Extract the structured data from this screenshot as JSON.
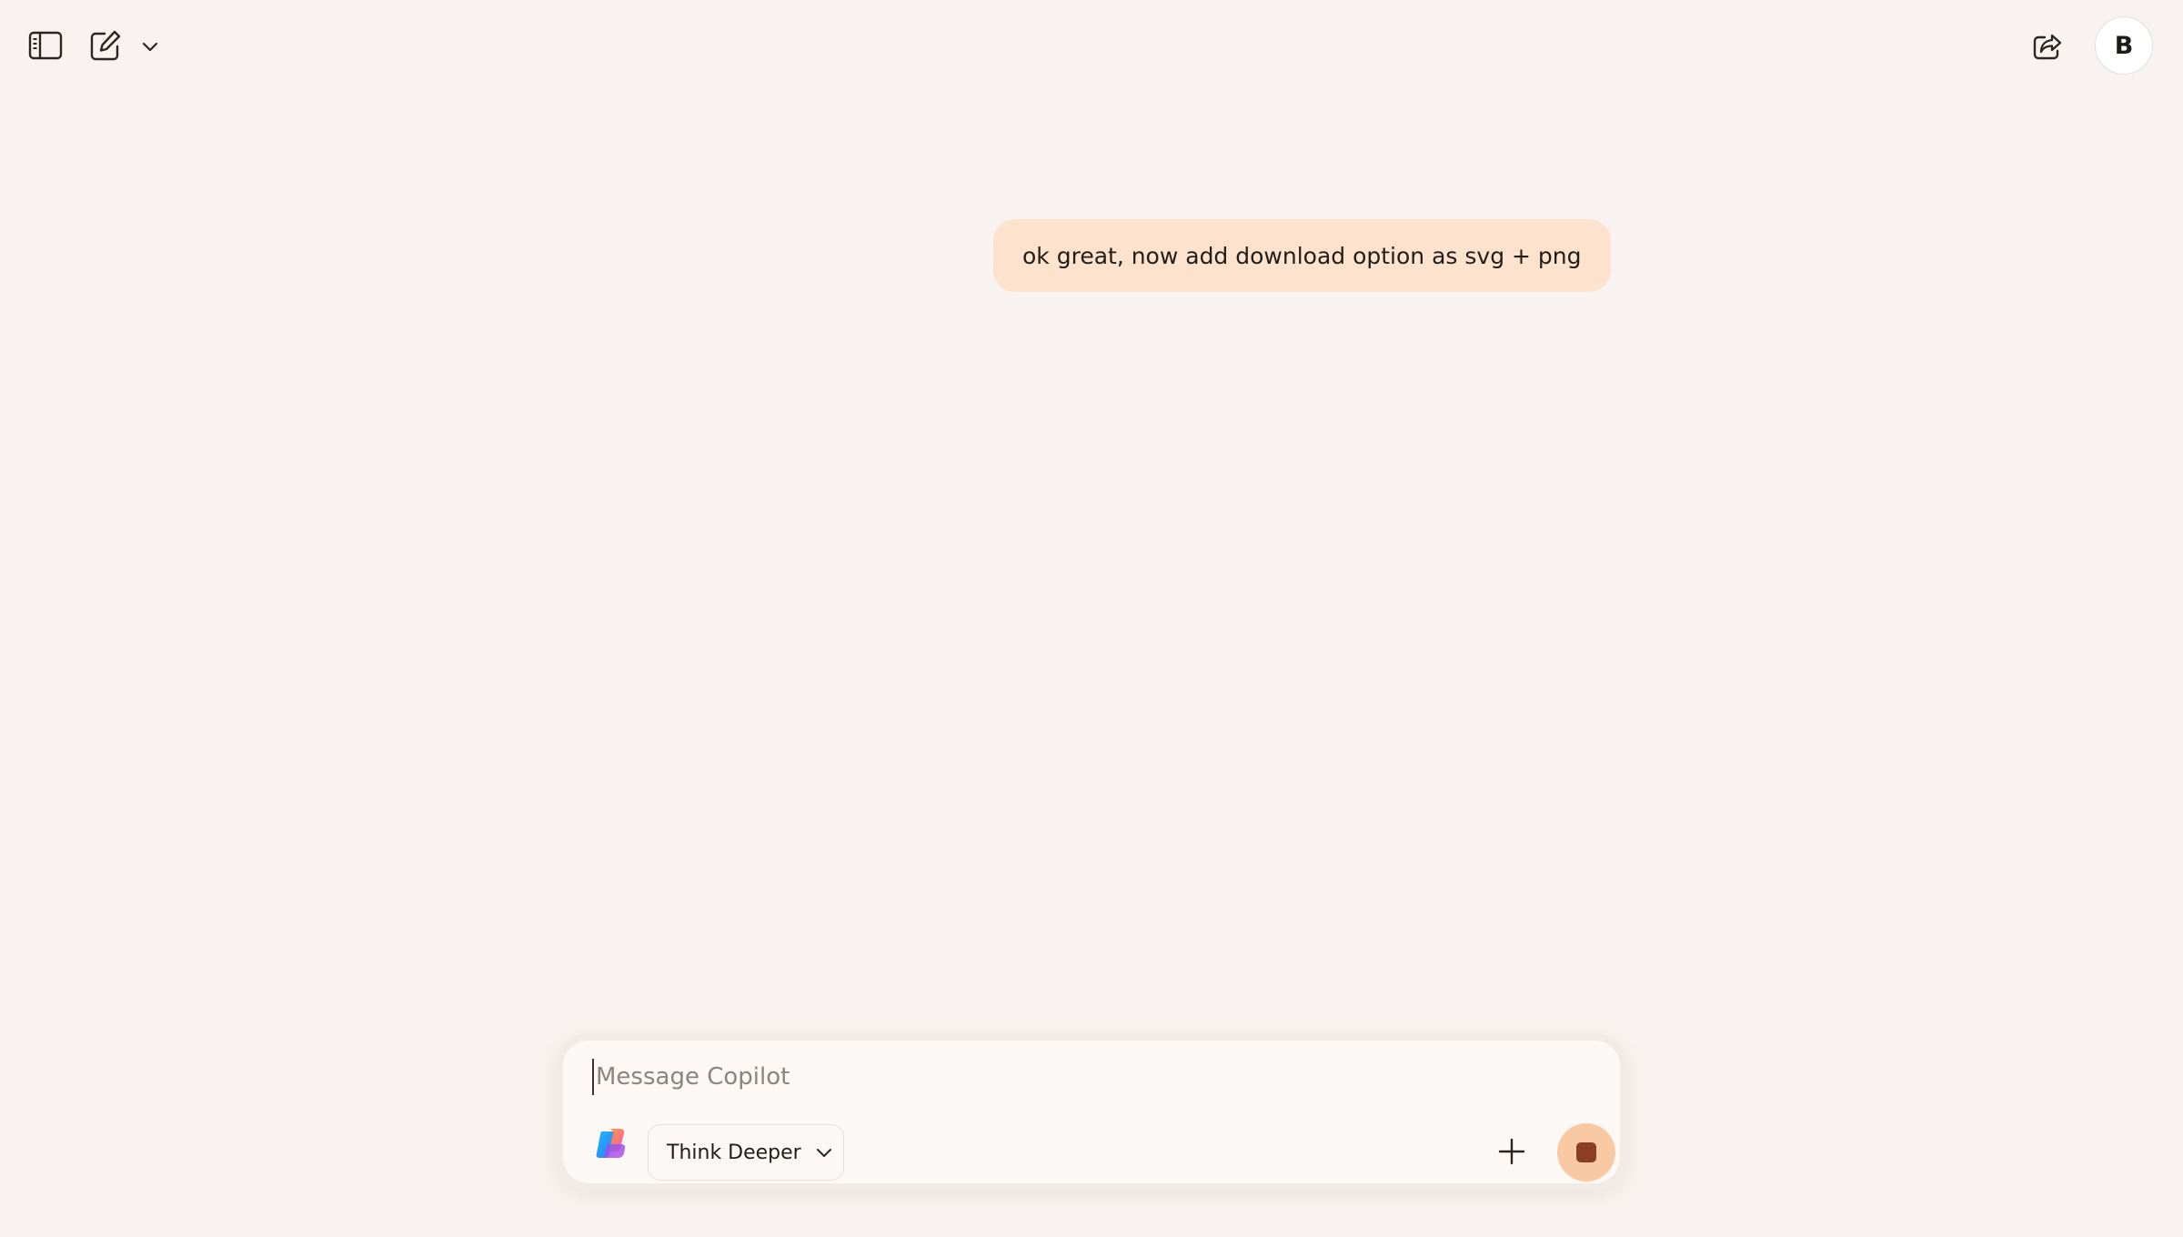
{
  "header": {
    "sidebar_toggle_icon": "sidebar-panel-icon",
    "new_chat_icon": "compose-icon",
    "new_chat_menu_icon": "chevron-down-icon",
    "share_icon": "share-icon",
    "avatar_initial": "B"
  },
  "conversation": {
    "messages": [
      {
        "role": "user",
        "text": "ok great, now add download option as svg + png"
      }
    ]
  },
  "composer": {
    "placeholder": "Message Copilot",
    "value": "",
    "logo_icon": "copilot-logo-icon",
    "mode": {
      "selected": "Think Deeper",
      "icon": "chevron-down-icon"
    },
    "add_icon": "plus-icon",
    "stop_icon": "stop-icon"
  },
  "colors": {
    "background": "#f8f3f0",
    "user_bubble": "#fde2cd",
    "stop_button": "#f9c9a4",
    "stop_square": "#8a3e22"
  }
}
